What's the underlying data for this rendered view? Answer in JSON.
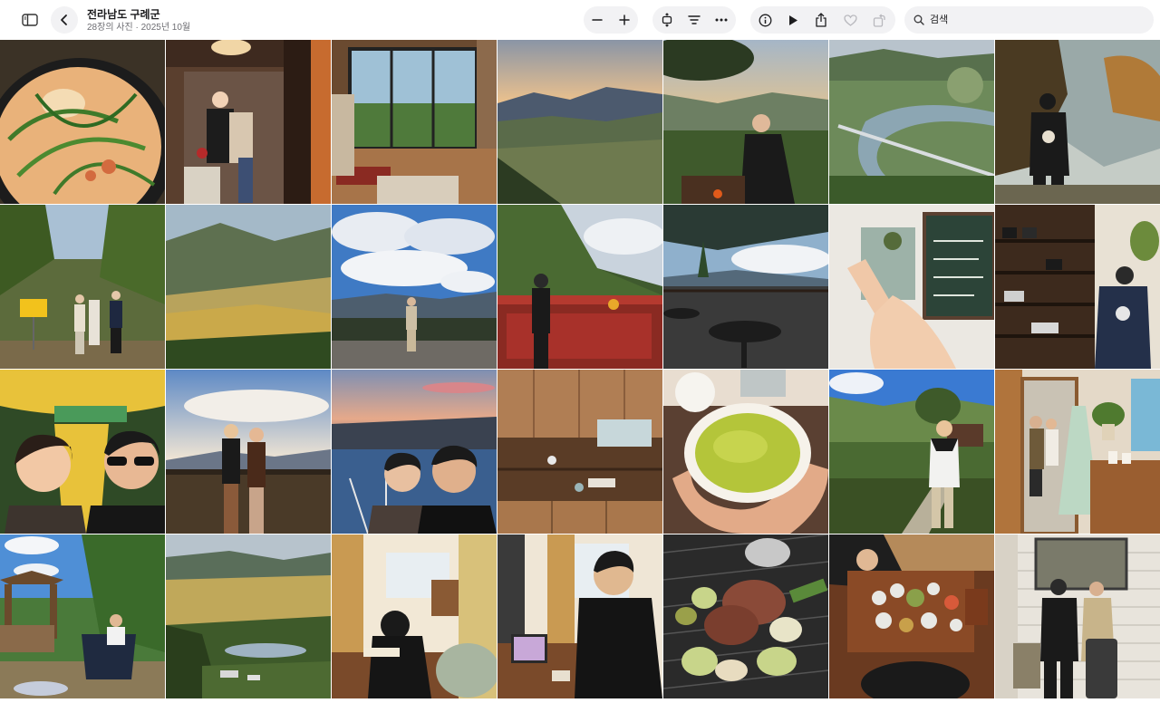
{
  "header": {
    "title": "전라남도 구례군",
    "subtitle": "28장의 사진 · 2025년 10월"
  },
  "toolbar": {
    "sidebar_icon": "sidebar-icon",
    "back_icon": "chevron-left-icon",
    "zoom_out_icon": "minus-icon",
    "zoom_in_icon": "plus-icon",
    "aspect_icon": "aspect-ratio-icon",
    "filter_icon": "filter-icon",
    "more_icon": "ellipsis-icon",
    "info_icon": "info-icon",
    "slideshow_icon": "play-icon",
    "share_icon": "share-icon",
    "favorite_icon": "heart-icon",
    "rotate_icon": "rotate-icon"
  },
  "search": {
    "placeholder": "검색"
  },
  "photos": [
    "soup",
    "cafe-mirror",
    "living-room",
    "valley-sunset",
    "bbq-man",
    "river-bridge",
    "man-tree-photo",
    "forest-sign",
    "mountain-valley",
    "cloudy-sky",
    "balcony-woman",
    "cafe-terrace",
    "peace-sign",
    "camera-shelf",
    "train-selfie",
    "mountain-couple",
    "dusk-selfie",
    "kitchen-shelf",
    "matcha-bowl",
    "woman-garden",
    "mirror-dress",
    "camping-chair",
    "valley-lake",
    "reading-desk",
    "laptop-man",
    "grill-meat",
    "korean-table",
    "station-mirror"
  ]
}
